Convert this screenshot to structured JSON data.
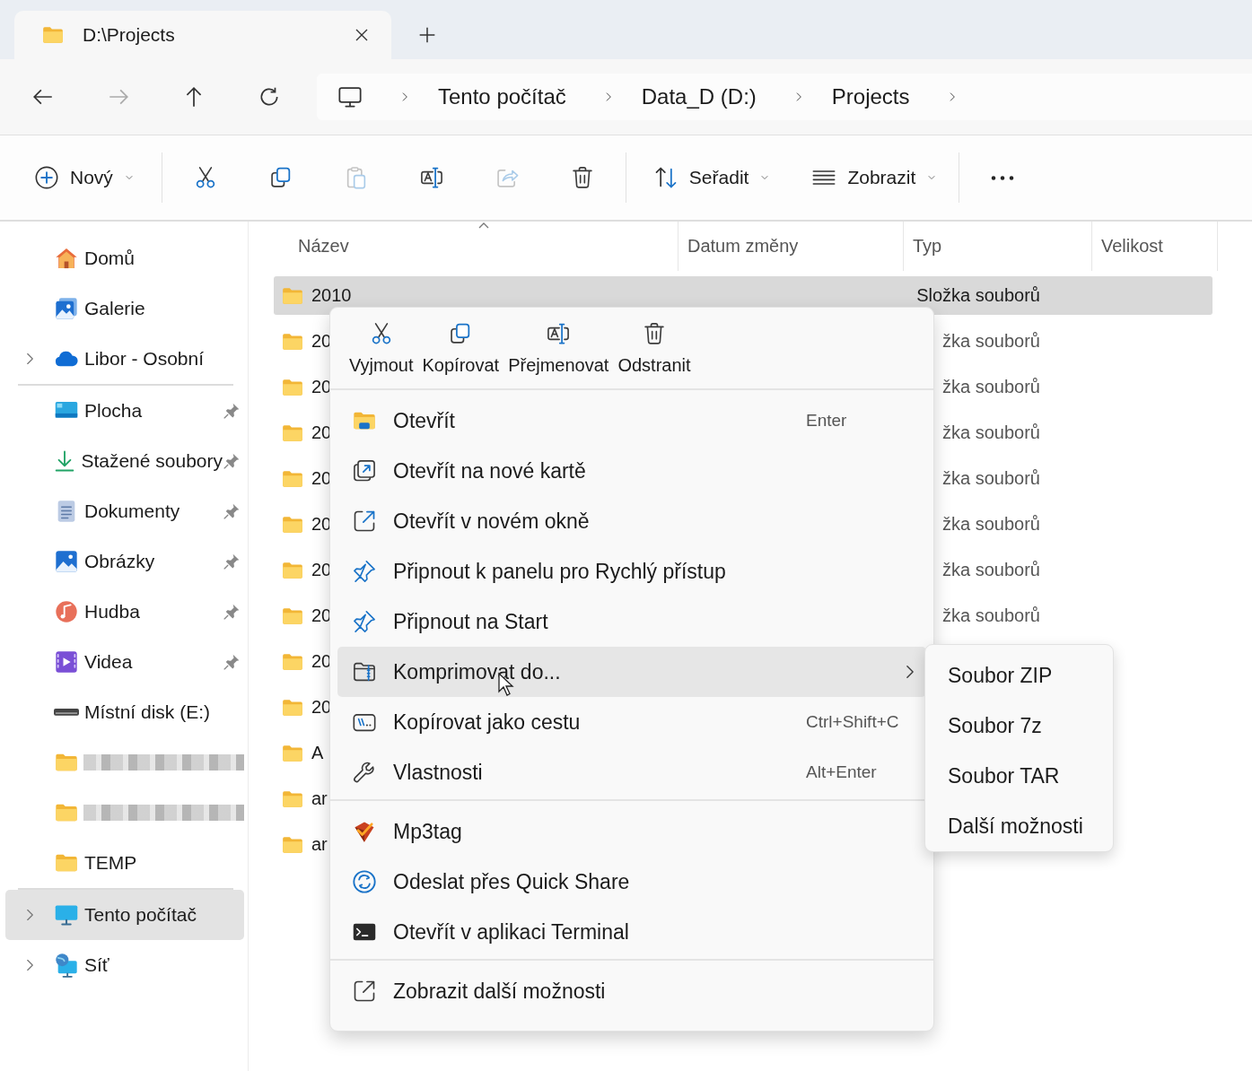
{
  "tabs": [
    {
      "title": "D:\\Projects",
      "selected": true
    }
  ],
  "breadcrumb": [
    "Tento počítač",
    "Data_D (D:)",
    "Projects"
  ],
  "toolbar": {
    "new_label": "Nový",
    "sort_label": "Seřadit",
    "view_label": "Zobrazit",
    "tools": [
      {
        "kind": "cut",
        "disabled": false
      },
      {
        "kind": "copy",
        "disabled": false
      },
      {
        "kind": "paste",
        "disabled": true
      },
      {
        "kind": "rename",
        "disabled": false
      },
      {
        "kind": "share",
        "disabled": true
      },
      {
        "kind": "delete",
        "disabled": false
      }
    ]
  },
  "sidebar": {
    "sections": [
      [
        {
          "kind": "home",
          "label": "Domů",
          "pinned": false,
          "expandable": false,
          "selected": false
        },
        {
          "kind": "gallery",
          "label": "Galerie",
          "pinned": false,
          "expandable": false,
          "selected": false
        },
        {
          "kind": "cloud",
          "label": "Libor - Osobní",
          "pinned": false,
          "expandable": true,
          "selected": false
        }
      ],
      [
        {
          "kind": "desktop",
          "label": "Plocha",
          "pinned": true,
          "expandable": false,
          "selected": false
        },
        {
          "kind": "download",
          "label": "Stažené soubory",
          "pinned": true,
          "expandable": false,
          "selected": false
        },
        {
          "kind": "documents",
          "label": "Dokumenty",
          "pinned": true,
          "expandable": false,
          "selected": false
        },
        {
          "kind": "pictures",
          "label": "Obrázky",
          "pinned": true,
          "expandable": false,
          "selected": false
        },
        {
          "kind": "music",
          "label": "Hudba",
          "pinned": true,
          "expandable": false,
          "selected": false
        },
        {
          "kind": "videos",
          "label": "Videa",
          "pinned": true,
          "expandable": false,
          "selected": false
        },
        {
          "kind": "drive",
          "label": "Místní disk (E:)",
          "pinned": false,
          "expandable": false,
          "selected": false
        },
        {
          "kind": "folder",
          "blurred": true,
          "pinned": false,
          "expandable": false,
          "selected": false
        },
        {
          "kind": "folder",
          "blurred": true,
          "pinned": false,
          "expandable": false,
          "selected": false
        },
        {
          "kind": "folder",
          "label": "TEMP",
          "pinned": false,
          "expandable": false,
          "selected": false
        }
      ],
      [
        {
          "kind": "pc",
          "label": "Tento počítač",
          "pinned": false,
          "expandable": true,
          "selected": true
        },
        {
          "kind": "network",
          "label": "Síť",
          "pinned": false,
          "expandable": true,
          "selected": false
        }
      ]
    ]
  },
  "columns": [
    "Název",
    "Datum změny",
    "Typ",
    "Velikost"
  ],
  "rows": [
    {
      "name": "2010",
      "type": "Složka souborů",
      "selected": true
    },
    {
      "name": "20",
      "type": "žka souborů",
      "selected": false
    },
    {
      "name": "20",
      "type": "žka souborů",
      "selected": false
    },
    {
      "name": "20",
      "type": "žka souborů",
      "selected": false
    },
    {
      "name": "20",
      "type": "žka souborů",
      "selected": false
    },
    {
      "name": "20",
      "type": "žka souborů",
      "selected": false
    },
    {
      "name": "20",
      "type": "žka souborů",
      "selected": false
    },
    {
      "name": "20",
      "type": "žka souborů",
      "selected": false
    },
    {
      "name": "20",
      "selected": false
    },
    {
      "name": "20",
      "selected": false
    },
    {
      "name": "A",
      "selected": false
    },
    {
      "name": "ar",
      "selected": false
    },
    {
      "name": "ar",
      "selected": false
    }
  ],
  "context_menu": {
    "quick_actions": [
      {
        "kind": "cut",
        "label": "Vyjmout"
      },
      {
        "kind": "copy",
        "label": "Kopírovat"
      },
      {
        "kind": "rename",
        "label": "Přejmenovat"
      },
      {
        "kind": "delete",
        "label": "Odstranit"
      }
    ],
    "sections": [
      [
        {
          "kind": "open",
          "label": "Otevřít",
          "shortcut": "Enter",
          "highlighted": false,
          "has_submenu": false
        },
        {
          "kind": "newtab",
          "label": "Otevřít na nové kartě",
          "highlighted": false,
          "has_submenu": false
        },
        {
          "kind": "newwindow",
          "label": "Otevřít v novém okně",
          "highlighted": false,
          "has_submenu": false
        },
        {
          "kind": "pin",
          "label": "Připnout k panelu pro Rychlý přístup",
          "highlighted": false,
          "has_submenu": false
        },
        {
          "kind": "pin",
          "label": "Připnout na Start",
          "highlighted": false,
          "has_submenu": false
        },
        {
          "kind": "zip",
          "label": "Komprimovat do...",
          "highlighted": true,
          "has_submenu": true
        },
        {
          "kind": "path",
          "label": "Kopírovat jako cestu",
          "shortcut": "Ctrl+Shift+C",
          "highlighted": false,
          "has_submenu": false
        },
        {
          "kind": "wrench",
          "label": "Vlastnosti",
          "shortcut": "Alt+Enter",
          "highlighted": false,
          "has_submenu": false
        }
      ],
      [
        {
          "kind": "mp3tag",
          "label": "Mp3tag",
          "highlighted": false,
          "has_submenu": false
        },
        {
          "kind": "quickshare",
          "label": "Odeslat přes Quick Share",
          "highlighted": false,
          "has_submenu": false
        },
        {
          "kind": "terminal",
          "label": "Otevřít v aplikaci Terminal",
          "highlighted": false,
          "has_submenu": false
        }
      ],
      [
        {
          "kind": "more",
          "label": "Zobrazit další možnosti",
          "highlighted": false,
          "has_submenu": false
        }
      ]
    ]
  },
  "submenu": [
    "Soubor ZIP",
    "Soubor 7z",
    "Soubor TAR",
    "Další možnosti"
  ]
}
